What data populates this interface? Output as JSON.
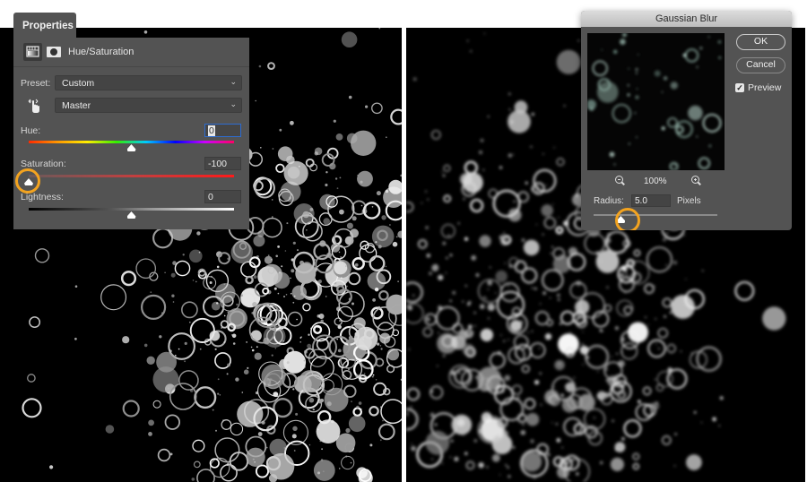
{
  "properties_panel": {
    "tab_label": "Properties",
    "adjustment_title": "Hue/Saturation",
    "icons": {
      "adjustment": "hue-saturation-adjustment-icon",
      "mask": "layer-mask-icon",
      "targeted_adjust": "targeted-adjustment-hand-icon"
    },
    "preset_label": "Preset:",
    "preset_value": "Custom",
    "channel_value": "Master",
    "hue": {
      "label": "Hue:",
      "value": "0",
      "slider_fraction": 0.5
    },
    "saturation": {
      "label": "Saturation:",
      "value": "-100",
      "slider_fraction": 0.0
    },
    "lightness": {
      "label": "Lightness:",
      "value": "0",
      "slider_fraction": 0.5
    },
    "highlight_color": "#f3a31f"
  },
  "gaussian_blur_dialog": {
    "title": "Gaussian Blur",
    "ok_label": "OK",
    "cancel_label": "Cancel",
    "preview_label": "Preview",
    "preview_checked": true,
    "zoom_level": "100%",
    "radius_label": "Radius:",
    "radius_value": "5.0",
    "radius_unit": "Pixels",
    "radius_slider_fraction": 0.22
  },
  "photos": {
    "left": "water-bubbles-black-white",
    "right": "water-bubbles-blurred"
  }
}
